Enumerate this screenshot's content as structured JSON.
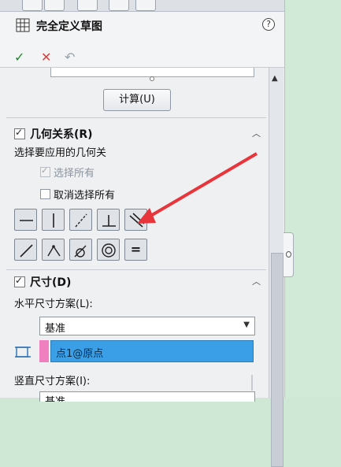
{
  "header": {
    "title": "完全定义草图",
    "help_icon": "help-icon",
    "ok_icon": "check-icon",
    "cancel_icon": "close-icon",
    "undo_icon": "undo-icon",
    "ok_glyph": "✓",
    "cancel_glyph": "✕",
    "undo_glyph": "↶",
    "help_glyph": "?"
  },
  "calculate": {
    "label": "计算(U)"
  },
  "relations": {
    "title": "几何关系(R)",
    "description": "选择要应用的几何关",
    "select_all": "选择所有",
    "deselect_all": "取消选择所有",
    "buttons_row1": [
      "horizontal",
      "vertical",
      "collinear",
      "perpendicular",
      "parallel"
    ],
    "buttons_row2": [
      "tangent-line",
      "midpoint",
      "tangent-arc",
      "concentric",
      "equal"
    ],
    "equal_glyph": "="
  },
  "dimensions": {
    "title": "尺寸(D)",
    "horizontal_scheme_label": "水平尺寸方案(L):",
    "horizontal_scheme_value": "基准",
    "origin_selection": "点1@原点",
    "vertical_scheme_label": "竖直尺寸方案(I):",
    "vertical_scheme_value": "基准"
  },
  "colors": {
    "selection_blue": "#3a9fe6",
    "selection_pink": "#f07fbf",
    "arrow_red": "#e8353c",
    "ok_green": "#1f8a2b",
    "cancel_red": "#e23b3b"
  }
}
